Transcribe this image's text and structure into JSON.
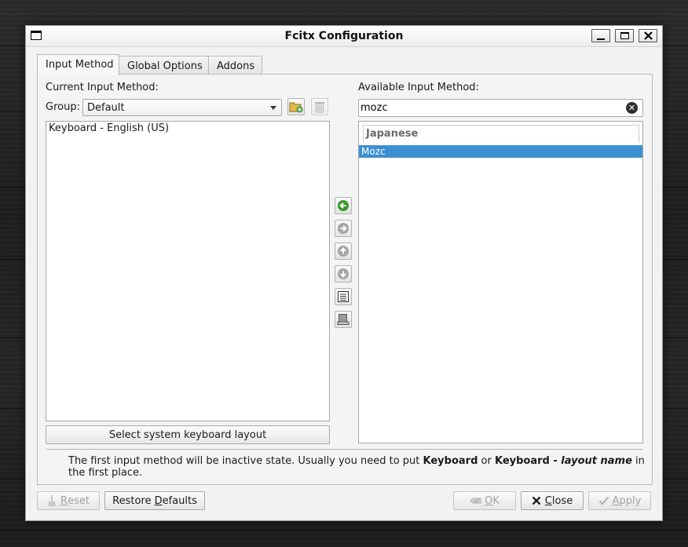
{
  "window": {
    "title": "Fcitx Configuration"
  },
  "tabs": [
    {
      "label": "Input Method",
      "active": true
    },
    {
      "label": "Global Options",
      "active": false
    },
    {
      "label": "Addons",
      "active": false
    }
  ],
  "current": {
    "heading": "Current Input Method:",
    "group_label": "Group:",
    "group_value": "Default",
    "items": [
      "Keyboard - English (US)"
    ],
    "keyboard_layout_button": "Select system keyboard layout"
  },
  "available": {
    "heading": "Available Input Method:",
    "search_value": "mozc",
    "group_header": "Japanese",
    "items": [
      "Mozc"
    ]
  },
  "info": {
    "text_1": "The first input method will be inactive state. Usually you need to put ",
    "bold_1": "Keyboard",
    "text_2": " or ",
    "bold_2": "Keyboard - ",
    "bold_italic": "layout name",
    "text_3": " in the first place."
  },
  "buttons": {
    "reset": {
      "first": "R",
      "rest": "eset"
    },
    "restore": {
      "before": "Restore ",
      "mnemonic": "D",
      "after": "efaults"
    },
    "ok": {
      "first": "O",
      "rest": "K"
    },
    "close": {
      "first": "C",
      "rest": "lose"
    },
    "apply": {
      "first": "A",
      "rest": "pply"
    }
  },
  "colors": {
    "selection": "#3d8fd1",
    "add_arrow": "#3a9a2e",
    "disabled_text": "#a3a3a3"
  },
  "icons": {
    "add_group": "folder-add-icon",
    "delete_group": "trash-icon",
    "add_im": "arrow-left-icon",
    "remove_im": "arrow-right-icon",
    "move_up": "arrow-up-icon",
    "move_down": "arrow-down-icon",
    "configure": "config-icon",
    "layout": "keyboard-layout-icon"
  }
}
